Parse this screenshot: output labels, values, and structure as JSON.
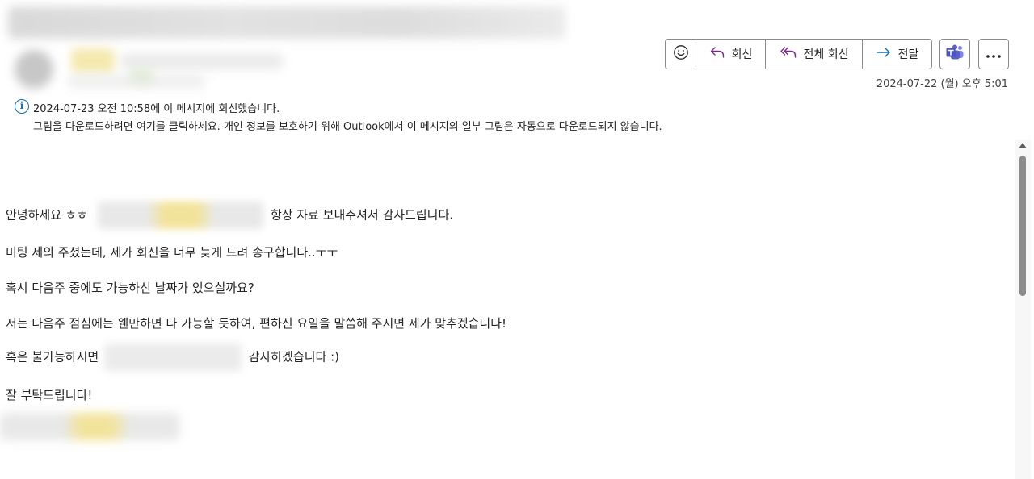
{
  "toolbar": {
    "emoji_icon": "smiley-icon",
    "reply_label": "회신",
    "reply_all_label": "전체 회신",
    "forward_label": "전달",
    "teams_icon": "teams-icon",
    "more_icon": "ellipsis-icon"
  },
  "message": {
    "received_date": "2024-07-22 (월) 오후 5:01"
  },
  "infobar": {
    "icon": "info-icon",
    "replied_notice": "2024-07-23 오전 10:58에 이 메시지에 회신했습니다.",
    "images_notice": "그림을 다운로드하려면 여기를 클릭하세요. 개인 정보를 보호하기 위해 Outlook에서 이 메시지의 일부 그림은 자동으로 다운로드되지 않습니다."
  },
  "body": {
    "line1_start": "안녕하세요 ㅎㅎ",
    "line1_end": "항상 자료 보내주셔서 감사드립니다.",
    "line2": "미팅 제의 주셨는데, 제가 회신을 너무 늦게 드려 송구합니다..ㅜㅜ",
    "line3": "혹시 다음주 중에도 가능하신 날짜가 있으실까요?",
    "line4": "저는 다음주 점심에는 웬만하면 다 가능할 듯하여, 편하신 요일을 말씀해 주시면 제가 맞추겠습니다!",
    "line5_start": "혹은 불가능하시면",
    "line5_end": "감사하겠습니다 :)",
    "line6": "잘 부탁드립니다!"
  },
  "colors": {
    "accent": "#0f6cbd",
    "reply_icon": "#7a2b8a",
    "forward_icon": "#0f6cbd",
    "teams": "#5b5fc7",
    "highlight_blur": "#f2e39a"
  }
}
